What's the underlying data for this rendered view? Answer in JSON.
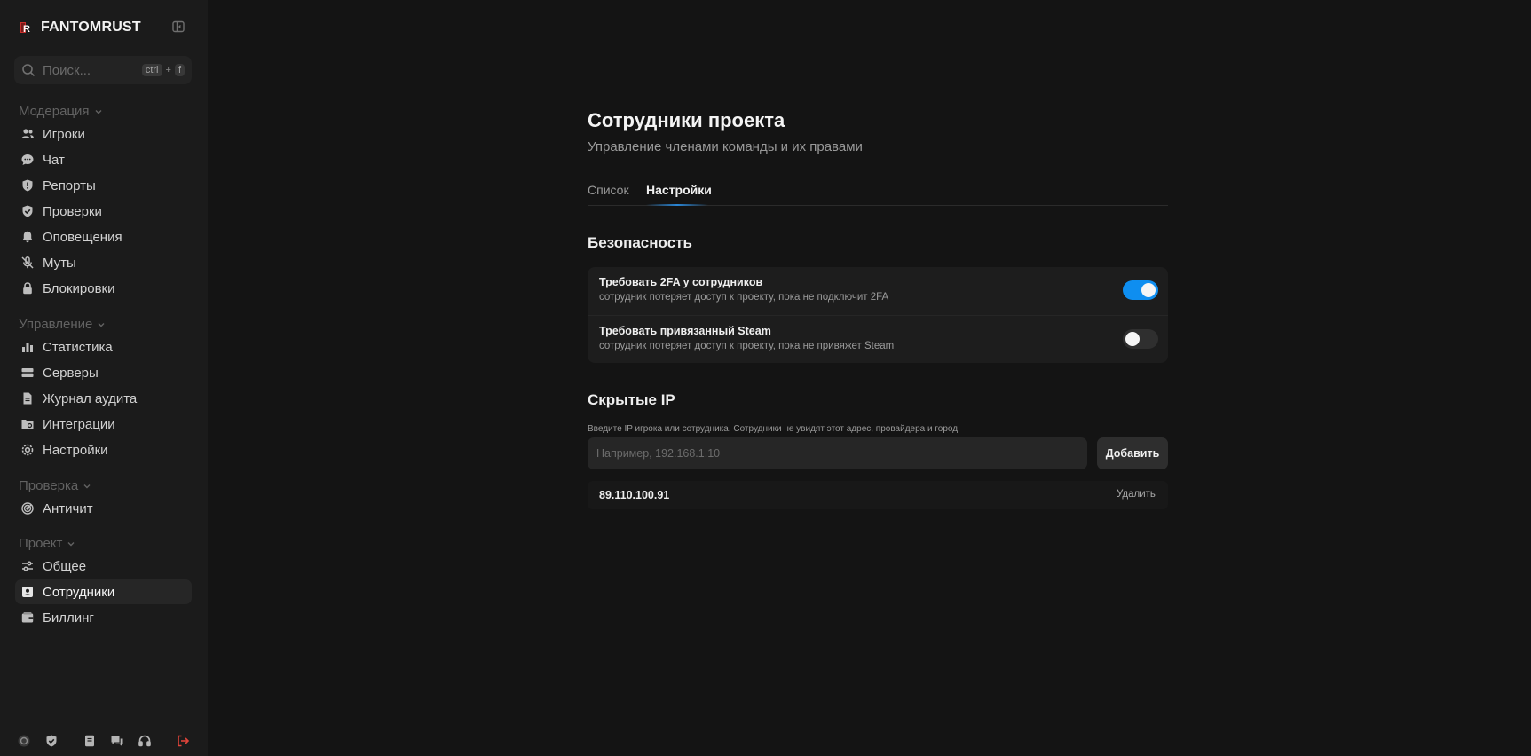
{
  "brand": {
    "title": "FANTOMRUST"
  },
  "search": {
    "placeholder": "Поиск...",
    "key1": "ctrl",
    "plus": "+",
    "key2": "f"
  },
  "sidebar": {
    "groups": [
      {
        "label": "Модерация",
        "items": [
          "Игроки",
          "Чат",
          "Репорты",
          "Проверки",
          "Оповещения",
          "Муты",
          "Блокировки"
        ]
      },
      {
        "label": "Управление",
        "items": [
          "Статистика",
          "Серверы",
          "Журнал аудита",
          "Интеграции",
          "Настройки"
        ]
      },
      {
        "label": "Проверка",
        "items": [
          "Античит"
        ]
      },
      {
        "label": "Проект",
        "items": [
          "Общее",
          "Сотрудники",
          "Биллинг"
        ]
      }
    ],
    "active_item": "Сотрудники"
  },
  "page": {
    "title": "Сотрудники проекта",
    "subtitle": "Управление членами команды и их правами",
    "tabs": [
      {
        "label": "Список",
        "active": false
      },
      {
        "label": "Настройки",
        "active": true
      }
    ]
  },
  "security": {
    "title": "Безопасность",
    "settings": [
      {
        "title": "Требовать 2FA у сотрудников",
        "description": "сотрудник потеряет доступ к проекту, пока не подключит 2FA",
        "enabled": true
      },
      {
        "title": "Требовать привязанный Steam",
        "description": "сотрудник потеряет доступ к проекту, пока не привяжет Steam",
        "enabled": false
      }
    ]
  },
  "hidden_ips": {
    "title": "Скрытые IP",
    "hint": "Введите IP игрока или сотрудника. Сотрудники не увидят этот адрес, провайдера и город.",
    "input_placeholder": "Например, 192.168.1.10",
    "add_label": "Добавить",
    "items": [
      {
        "ip": "89.110.100.91",
        "delete_label": "Удалить"
      }
    ]
  },
  "colors": {
    "accent": "#0e8ef0",
    "logout": "#e0443a",
    "background": "#141414",
    "sidebar": "#1b1b1b"
  }
}
